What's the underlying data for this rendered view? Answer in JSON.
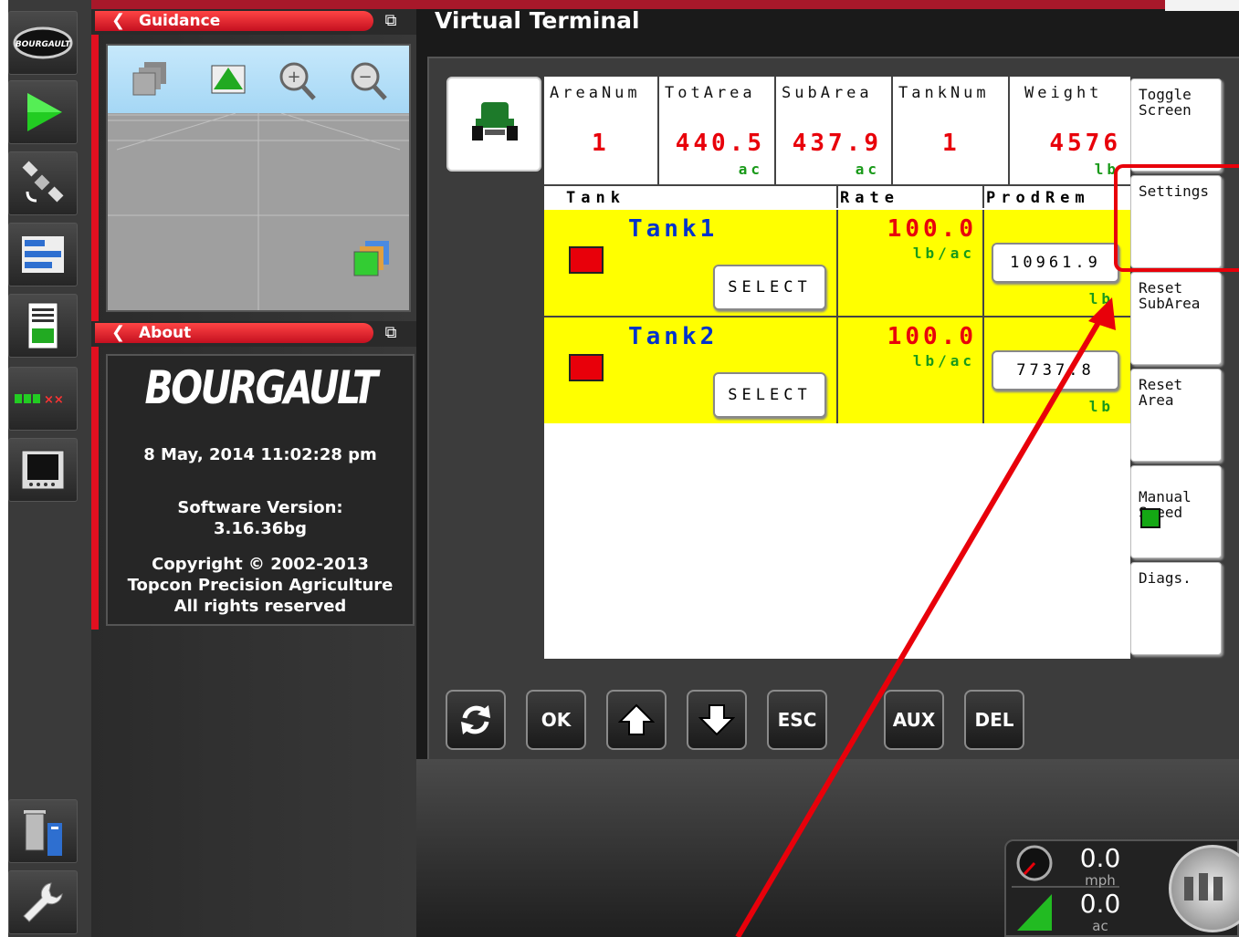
{
  "title": "Virtual Terminal",
  "left_panel": {
    "guidance_label": "Guidance",
    "about_label": "About",
    "brand": "BOURGAULT",
    "date_time": "8 May, 2014  11:02:28 pm",
    "software_label": "Software Version:",
    "software_version": "3.16.36bg",
    "copyright": "Copyright © 2002-2013",
    "company": "Topcon Precision Agriculture",
    "rights": "All rights reserved"
  },
  "rail": {
    "logo_text": "BOURGAULT",
    "icons": [
      "bourgault-logo-icon",
      "play-guidance-icon",
      "satellite-icon",
      "list-bars-icon",
      "document-icon",
      "section-status-icon",
      "video-screen-icon",
      "trash-delete-icon",
      "wrench-icon"
    ]
  },
  "header": [
    {
      "label": "AreaNum",
      "value": "1",
      "unit": ""
    },
    {
      "label": "TotArea",
      "value": "440.5",
      "unit": "ac"
    },
    {
      "label": "SubArea",
      "value": "437.9",
      "unit": "ac"
    },
    {
      "label": "TankNum",
      "value": "1",
      "unit": ""
    },
    {
      "label": "Weight",
      "value": "4576",
      "unit": "lb"
    }
  ],
  "columns": [
    "Tank",
    "Rate",
    "ProdRem"
  ],
  "tanks": [
    {
      "name": "Tank1",
      "select": "SELECT",
      "rate": "100.0",
      "rate_unit": "lb/ac",
      "remaining": "10961.9",
      "remaining_unit": "lb"
    },
    {
      "name": "Tank2",
      "select": "SELECT",
      "rate": "100.0",
      "rate_unit": "lb/ac",
      "remaining": "7737.8",
      "remaining_unit": "lb"
    }
  ],
  "softkeys": {
    "toggle": "Toggle\nScreen",
    "settings": "Settings",
    "reset_subarea": "Reset\nSubArea",
    "reset_area": "Reset\nArea",
    "manual_speed": "Manual\nSpeed",
    "diags": "Diags."
  },
  "nav": {
    "ok": "OK",
    "esc": "ESC",
    "aux": "AUX",
    "del": "DEL"
  },
  "speed": {
    "value": "0.0",
    "unit": "mph"
  },
  "area": {
    "value": "0.0",
    "unit": "ac"
  },
  "colors": {
    "accent": "#e8000a",
    "highlight_yellow": "#ffff00",
    "tank_blue": "#0033cc",
    "unit_green": "#1a9a1a"
  }
}
